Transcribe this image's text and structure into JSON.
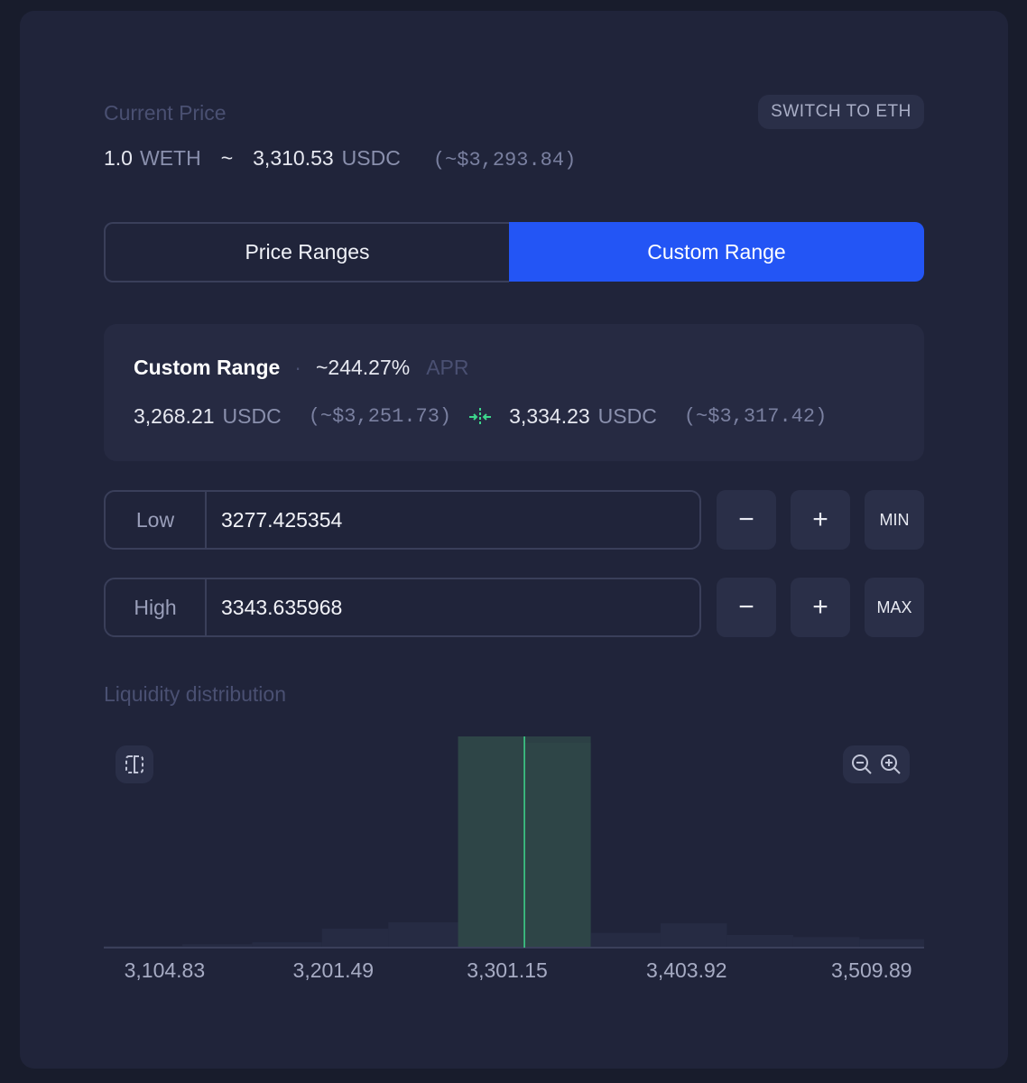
{
  "current_price": {
    "label": "Current Price",
    "base_amount": "1.0",
    "base_token": "WETH",
    "separator": "~",
    "quote_amount": "3,310.53",
    "quote_token": "USDC",
    "usd": "(~$3,293.84)"
  },
  "switch_button": "SWITCH TO ETH",
  "tabs": {
    "left": "Price Ranges",
    "right": "Custom Range",
    "active": "Custom Range"
  },
  "range_summary": {
    "title": "Custom Range",
    "dot": "·",
    "apr_value": "~244.27%",
    "apr_label": "APR",
    "low_amount": "3,268.21",
    "low_token": "USDC",
    "low_usd": "(~$3,251.73)",
    "high_amount": "3,334.23",
    "high_token": "USDC",
    "high_usd": "(~$3,317.42)",
    "range_icon": "arrows-inward-icon"
  },
  "low_input": {
    "label": "Low",
    "value": "3277.425354",
    "minus": "−",
    "plus": "+",
    "extra": "MIN"
  },
  "high_input": {
    "label": "High",
    "value": "3343.635968",
    "minus": "−",
    "plus": "+",
    "extra": "MAX"
  },
  "liquidity": {
    "label": "Liquidity distribution",
    "icons": [
      "split-view-icon",
      "zoom-out-icon",
      "zoom-in-icon"
    ]
  },
  "chart_data": {
    "type": "bar",
    "title": "",
    "x_ticks": [
      "3,104.83",
      "3,201.49",
      "3,301.15",
      "3,403.92",
      "3,509.89"
    ],
    "x_tick_values": [
      3104.83,
      3201.49,
      3301.15,
      3403.92,
      3509.89
    ],
    "xlim": [
      3070,
      3540
    ],
    "bins": [
      {
        "x0": 3070,
        "x1": 3115,
        "v": 0.008
      },
      {
        "x0": 3115,
        "x1": 3155,
        "v": 0.016
      },
      {
        "x0": 3155,
        "x1": 3195,
        "v": 0.025
      },
      {
        "x0": 3195,
        "x1": 3233,
        "v": 0.09
      },
      {
        "x0": 3233,
        "x1": 3273,
        "v": 0.12
      },
      {
        "x0": 3273,
        "x1": 3311,
        "v": 1.0
      },
      {
        "x0": 3311,
        "x1": 3349,
        "v": 0.97
      },
      {
        "x0": 3349,
        "x1": 3389,
        "v": 0.07
      },
      {
        "x0": 3389,
        "x1": 3427,
        "v": 0.115
      },
      {
        "x0": 3427,
        "x1": 3465,
        "v": 0.06
      },
      {
        "x0": 3465,
        "x1": 3503,
        "v": 0.05
      },
      {
        "x0": 3503,
        "x1": 3540,
        "v": 0.04
      }
    ],
    "selected_range": [
      3273,
      3349
    ],
    "current_price": 3311,
    "colors": {
      "bar": "#262b43",
      "selected": "#2f4548",
      "price_line": "#3dd68c"
    }
  },
  "colors": {
    "accent": "#2355f5",
    "panel": "#20243a",
    "background": "#181c2c"
  }
}
